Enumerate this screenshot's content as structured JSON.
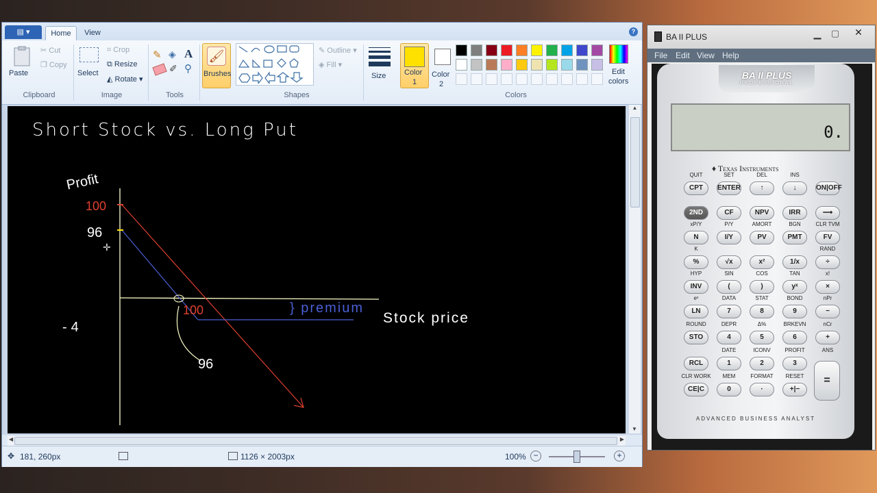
{
  "paint": {
    "ribbon_tabs": {
      "file_menu_glyph": "▾",
      "home": "Home",
      "view": "View",
      "help_icon": "?"
    },
    "clipboard": {
      "paste": "Paste",
      "cut": "Cut",
      "copy": "Copy",
      "label": "Clipboard"
    },
    "image": {
      "select": "Select",
      "crop": "Crop",
      "resize": "Resize",
      "rotate": "Rotate",
      "label": "Image"
    },
    "tools": {
      "label": "Tools"
    },
    "brushes": {
      "label": "Brushes"
    },
    "shapes": {
      "outline": "Outline",
      "fill": "Fill",
      "label": "Shapes"
    },
    "size": {
      "label": "Size"
    },
    "colors": {
      "color1": "Color\n1",
      "color1_a": "Color",
      "color1_b": "1",
      "color2_a": "Color",
      "color2_b": "2",
      "edit_a": "Edit",
      "edit_b": "colors",
      "label": "Colors",
      "color1_value": "#ffe100",
      "row1": [
        "#000000",
        "#7f7f7f",
        "#880015",
        "#ed1c24",
        "#ff7f27",
        "#fff200",
        "#22b14c",
        "#00a2e8",
        "#3f48cc",
        "#a349a4"
      ],
      "row2": [
        "#ffffff",
        "#c3c3c3",
        "#b97a57",
        "#ffaec9",
        "#ffc90e",
        "#efe4b0",
        "#b5e61d",
        "#99d9ea",
        "#7092be",
        "#c8bfe7"
      ]
    },
    "canvas_text": {
      "title": "Short Stock vs. Long Put",
      "profit": "Profit",
      "y100": "100",
      "y96": "96",
      "neg4": "-4",
      "x100": "100",
      "x96": "96",
      "premium": "} premium",
      "stock_price": "Stock price"
    },
    "status": {
      "cursor_pos": "181, 260px",
      "image_size": "1126 × 2003px",
      "zoom": "100%"
    }
  },
  "calculator": {
    "title": "BA II PLUS",
    "menu": [
      "File",
      "Edit",
      "View",
      "Help"
    ],
    "brand_top": "BA II PLUS",
    "brand_sub": "PROFESSIONAL",
    "display": "0.",
    "maker": "Texas Instruments",
    "footer": "ADVANCED BUSINESS ANALYST"
  }
}
